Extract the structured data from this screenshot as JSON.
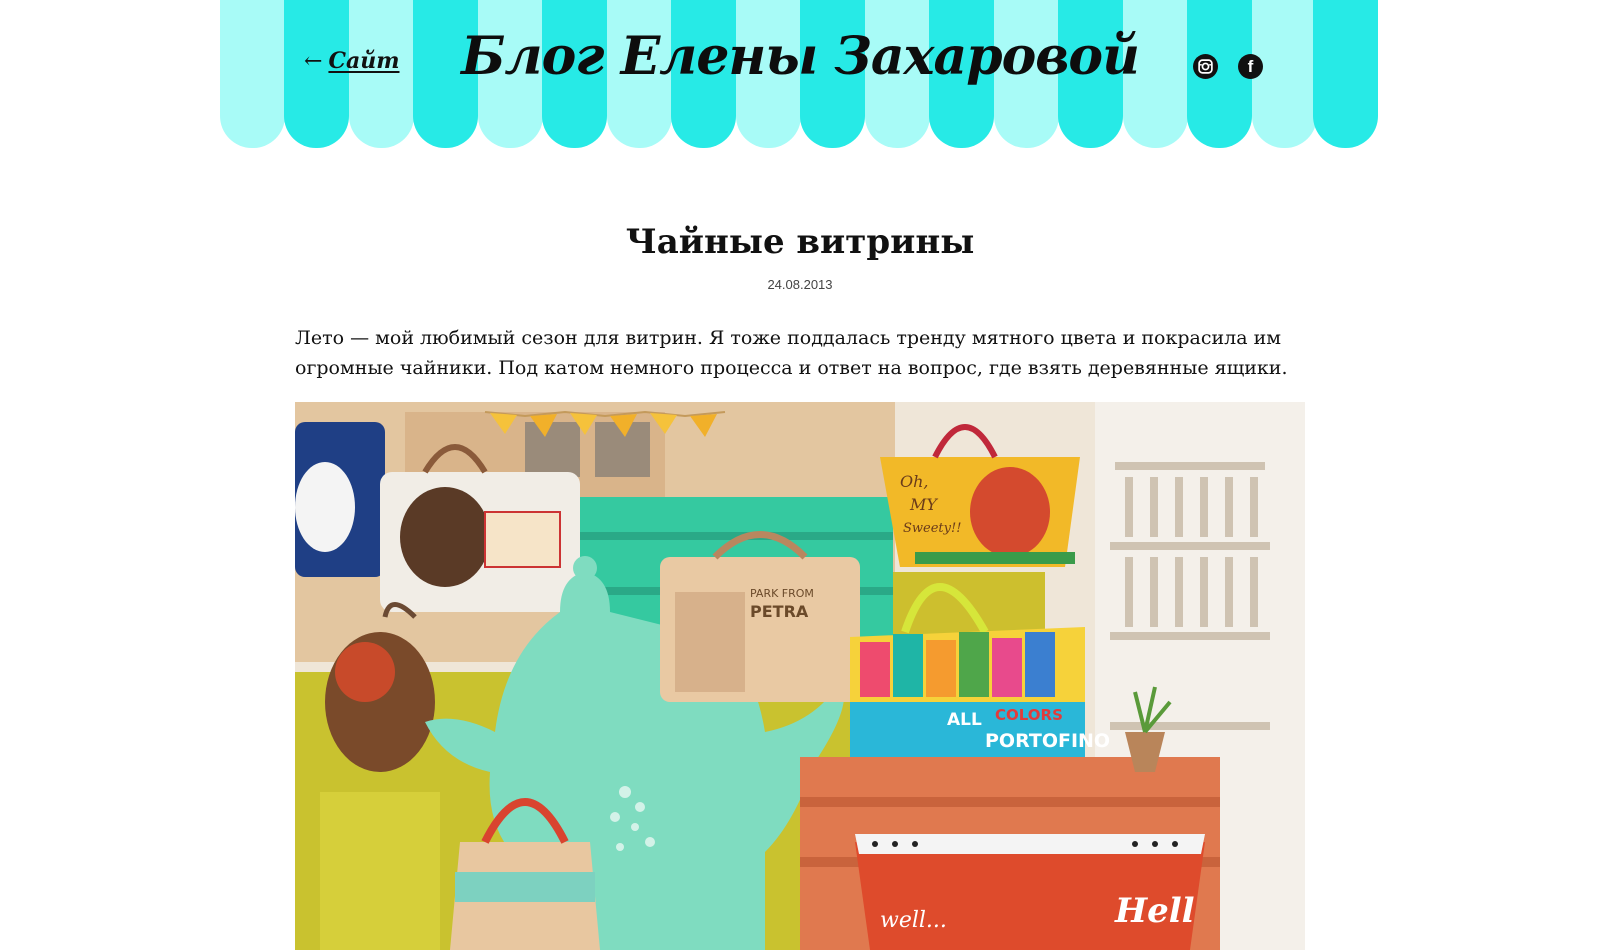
{
  "header": {
    "back_arrow": "←",
    "back_label": "Сайт",
    "blog_title": "Блог Елены Захаровой",
    "social": [
      {
        "name": "instagram",
        "icon": "instagram-icon"
      },
      {
        "name": "facebook",
        "icon": "facebook-icon",
        "glyph": "f"
      }
    ],
    "colors": {
      "stripe_light": "#a8fbf7",
      "stripe_dark": "#27eae6"
    }
  },
  "post": {
    "title": "Чайные витрины",
    "date": "24.08.2013",
    "intro": "Лето — мой любимый сезон для витрин. Я тоже поддалась тренду мятного цвета и покрасила им огромные чайники. Под катом немного процесса и ответ на вопрос, где взять деревянные ящики.",
    "photo": {
      "texts": {
        "bag_oh": "Oh,",
        "bag_my": "MY",
        "bag_sweety": "Sweety!!",
        "bag_petra_1": "PARK FROM",
        "bag_petra_2": "PETRA",
        "bag_all": "ALL",
        "bag_colors": "COLORS",
        "bag_portofino": "PORTOFINO",
        "bag_well": "well...",
        "bag_hello": "Hell"
      }
    }
  }
}
